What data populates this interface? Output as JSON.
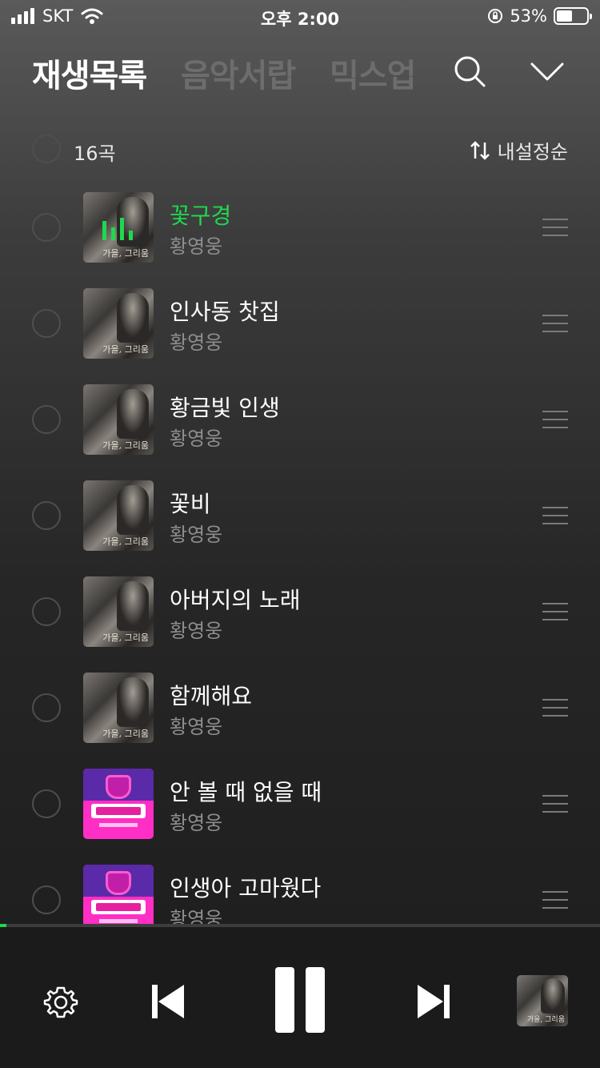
{
  "status_bar": {
    "carrier": "SKT",
    "time": "오후 2:00",
    "battery": "53%",
    "battery_level": 0.53
  },
  "header": {
    "tabs": [
      {
        "label": "재생목록",
        "active": true
      },
      {
        "label": "음악서랍",
        "active": false
      },
      {
        "label": "믹스업",
        "active": false
      }
    ],
    "search_icon": "search-icon",
    "collapse_icon": "chevron-down-icon"
  },
  "list_header": {
    "count": "16곡",
    "sort_label": "내설정순"
  },
  "tracks": [
    {
      "title": "꽃구경",
      "artist": "황영웅",
      "art": "photo",
      "art_caption": "가을, 그리움",
      "playing": true
    },
    {
      "title": "인사동 찻집",
      "artist": "황영웅",
      "art": "photo",
      "art_caption": "가을, 그리움",
      "playing": false
    },
    {
      "title": "황금빛 인생",
      "artist": "황영웅",
      "art": "photo",
      "art_caption": "가을, 그리움",
      "playing": false
    },
    {
      "title": "꽃비",
      "artist": "황영웅",
      "art": "photo",
      "art_caption": "가을, 그리움",
      "playing": false
    },
    {
      "title": "아버지의 노래",
      "artist": "황영웅",
      "art": "photo",
      "art_caption": "가을, 그리움",
      "playing": false
    },
    {
      "title": "함께해요",
      "artist": "황영웅",
      "art": "photo",
      "art_caption": "가을, 그리움",
      "playing": false
    },
    {
      "title": "안 볼 때 없을 때",
      "artist": "황영웅",
      "art": "pink",
      "playing": false
    },
    {
      "title": "인생아 고마웠다",
      "artist": "황영웅",
      "art": "pink",
      "playing": false
    }
  ],
  "player": {
    "progress": 0.01,
    "mini_art_caption": "가을, 그리움"
  },
  "colors": {
    "accent": "#1fd84e",
    "inactive_tab": "#6d6d6d",
    "artist_text": "#8e8e8e"
  }
}
